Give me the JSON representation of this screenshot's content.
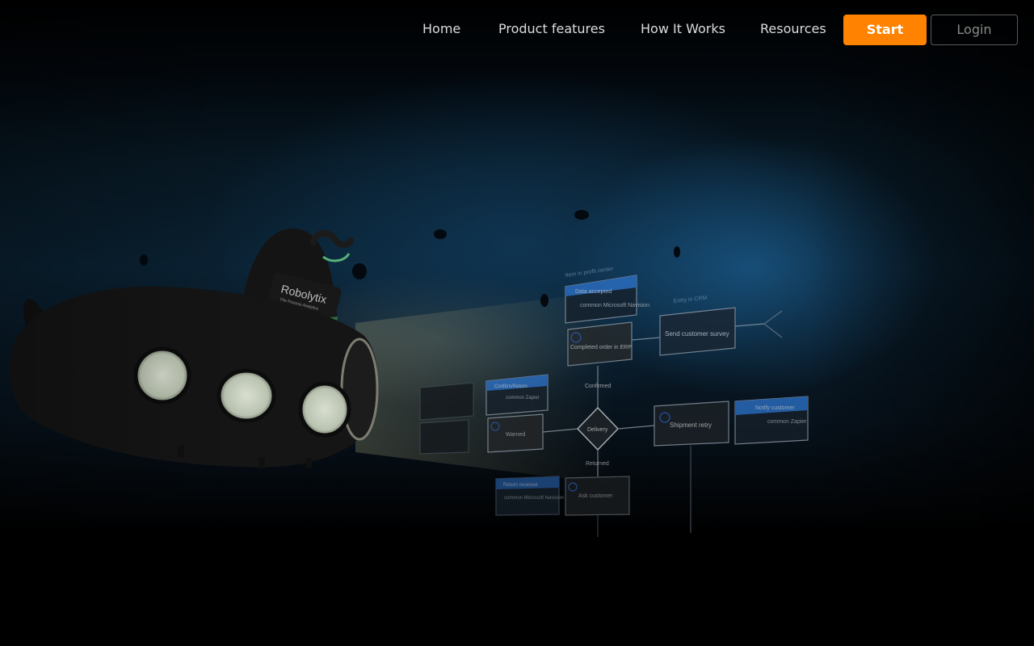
{
  "nav": {
    "links": [
      {
        "label": "Home"
      },
      {
        "label": "Product features"
      },
      {
        "label": "How It Works"
      },
      {
        "label": "Resources"
      }
    ],
    "start_label": "Start",
    "login_label": "Login"
  },
  "hero": {
    "submarine_brand": "Robolytix",
    "submarine_tagline": "The Process Analytics",
    "diagram": {
      "top_note": "Item in profit center",
      "erp_header": "Data accepted",
      "erp_app": "common\nMicrosoft Navision",
      "erp_node": "Completed order in ERP",
      "crm_note": "Entry in CRM",
      "survey_node": "Send customer survey",
      "left_header": "Confirm/Return",
      "left_app": "common\nZapier",
      "left_node": "Warned",
      "delivery": "Delivery",
      "confirmed": "Confirmed",
      "returned": "Returned",
      "shipment_retry": "Shipment retry",
      "zapier_header": "Notify customer",
      "zapier_app": "common\nZapier",
      "bottom_header": "Return received",
      "bottom_app": "common\nMicrosoft Navision",
      "bottom_node": "Ask customer"
    }
  },
  "colors": {
    "accent": "#ff8200",
    "nav_text": "#dcdcdc",
    "login_text": "#8a8a8a",
    "diagram_header": "#2c6fc4"
  }
}
